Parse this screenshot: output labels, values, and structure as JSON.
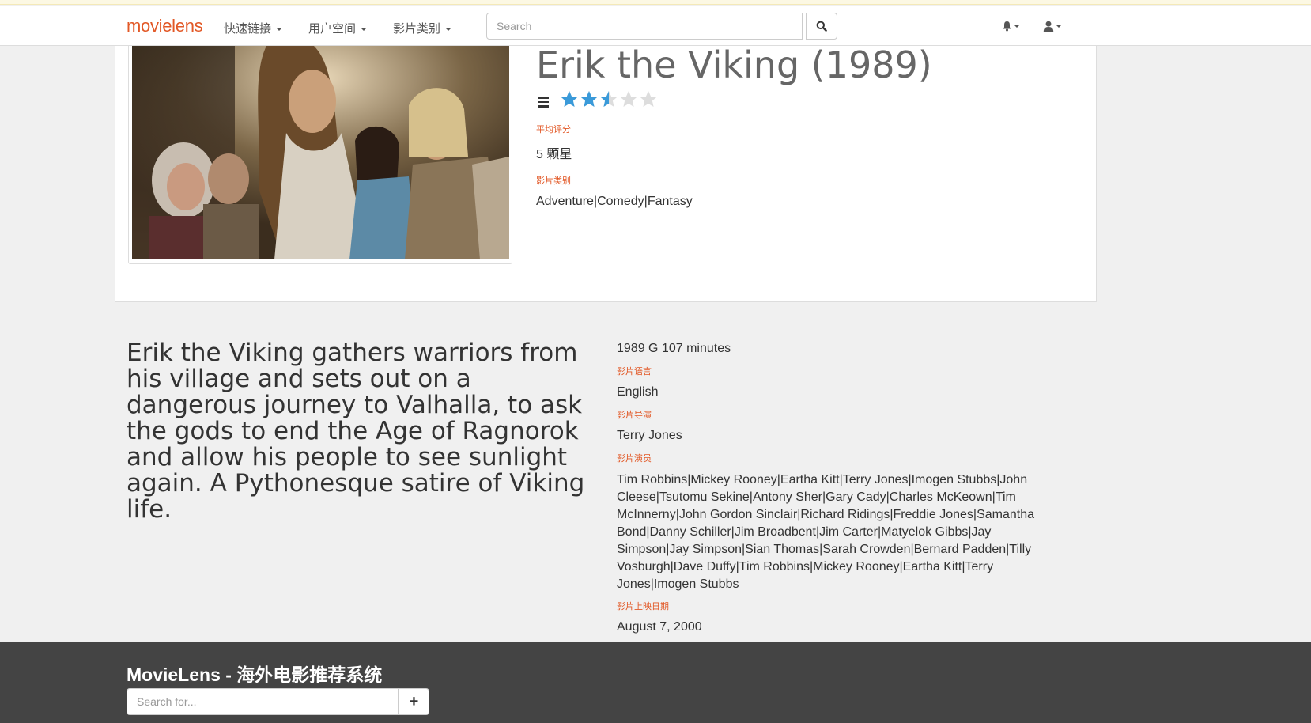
{
  "navbar": {
    "brand": "movielens",
    "links": [
      "快速链接",
      "用户空间",
      "影片类别"
    ],
    "search_placeholder": "Search",
    "icons": [
      "search-icon",
      "bell-icon",
      "user-icon"
    ]
  },
  "movie": {
    "title": "Erik the Viking (1989)",
    "rating_stars": 2.5,
    "rating_max": 5,
    "avg_rating_label": "平均评分",
    "avg_rating_value": "5 颗星",
    "genre_label": "影片类别",
    "genres": "Adventure|Comedy|Fantasy",
    "description": "Erik the Viking gathers warriors from his village and sets out on a dangerous journey to Valhalla, to ask the gods to end the Age of Ragnorok and allow his people to see sunlight again. A Pythonesque satire of Viking life.",
    "meta": "1989 G 107 minutes",
    "language_label": "影片语言",
    "language": "English",
    "director_label": "影片导演",
    "director": "Terry Jones",
    "cast_label": "影片演员",
    "cast": "Tim Robbins|Mickey Rooney|Eartha Kitt|Terry Jones|Imogen Stubbs|John Cleese|Tsutomu Sekine|Antony Sher|Gary Cady|Charles McKeown|Tim McInnerny|John Gordon Sinclair|Richard Ridings|Freddie Jones|Samantha Bond|Danny Schiller|Jim Broadbent|Jim Carter|Matyelok Gibbs|Jay Simpson|Jay Simpson|Sian Thomas|Sarah Crowden|Bernard Padden|Tilly Vosburgh|Dave Duffy|Tim Robbins|Mickey Rooney|Eartha Kitt|Terry Jones|Imogen Stubbs",
    "release_label": "影片上映日期",
    "release_date": "August 7, 2000"
  },
  "footer": {
    "title": "MovieLens - 海外电影推荐系统",
    "search_placeholder": "Search for...",
    "button_label": "+"
  },
  "colors": {
    "brand": "#e25826",
    "star_filled": "#3a9ad9",
    "star_empty": "#dddddd",
    "footer_bg": "#444444"
  }
}
